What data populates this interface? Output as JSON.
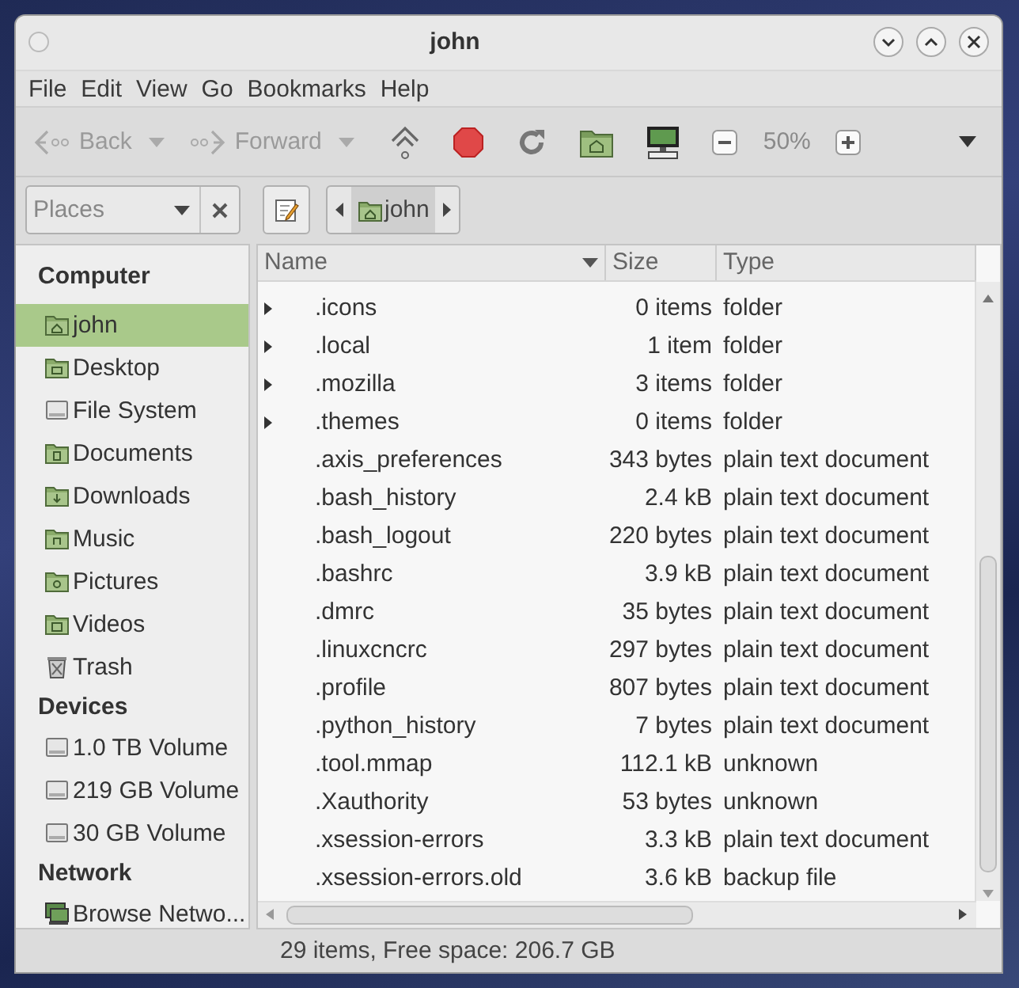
{
  "window": {
    "title": "john"
  },
  "menu": [
    "File",
    "Edit",
    "View",
    "Go",
    "Bookmarks",
    "Help"
  ],
  "toolbar": {
    "back": {
      "label": "Back",
      "disabled": true
    },
    "forward": {
      "label": "Forward",
      "disabled": true
    },
    "zoom": "50%"
  },
  "location": {
    "places": {
      "placeholder": "Places"
    },
    "path": [
      {
        "label": "john",
        "selected": true
      }
    ]
  },
  "sidebar": [
    {
      "title": "Computer",
      "items": [
        {
          "label": "john",
          "kind": "home",
          "selected": true
        },
        {
          "label": "Desktop",
          "kind": "desktop",
          "selected": false
        },
        {
          "label": "File System",
          "kind": "drive",
          "selected": false
        },
        {
          "label": "Documents",
          "kind": "documents",
          "selected": false
        },
        {
          "label": "Downloads",
          "kind": "downloads",
          "selected": false
        },
        {
          "label": "Music",
          "kind": "music",
          "selected": false
        },
        {
          "label": "Pictures",
          "kind": "pictures",
          "selected": false
        },
        {
          "label": "Videos",
          "kind": "videos",
          "selected": false
        },
        {
          "label": "Trash",
          "kind": "trash",
          "selected": false
        }
      ]
    },
    {
      "title": "Devices",
      "items": [
        {
          "label": "1.0 TB Volume",
          "kind": "drive",
          "selected": false
        },
        {
          "label": "219 GB Volume",
          "kind": "drive",
          "selected": false
        },
        {
          "label": "30 GB Volume",
          "kind": "drive",
          "selected": false
        }
      ]
    },
    {
      "title": "Network",
      "items": [
        {
          "label": "Browse Netwo...",
          "kind": "network",
          "selected": false
        }
      ]
    }
  ],
  "table": {
    "columns": [
      {
        "label": "Name",
        "sorted": true
      },
      {
        "label": "Size",
        "sorted": false
      },
      {
        "label": "Type",
        "sorted": false
      }
    ],
    "rows": [
      {
        "name": ".icons",
        "size": "0 items",
        "type": "folder",
        "expandable": true
      },
      {
        "name": ".local",
        "size": "1 item",
        "type": "folder",
        "expandable": true
      },
      {
        "name": ".mozilla",
        "size": "3 items",
        "type": "folder",
        "expandable": true
      },
      {
        "name": ".themes",
        "size": "0 items",
        "type": "folder",
        "expandable": true
      },
      {
        "name": ".axis_preferences",
        "size": "343 bytes",
        "type": "plain text document",
        "expandable": false
      },
      {
        "name": ".bash_history",
        "size": "2.4 kB",
        "type": "plain text document",
        "expandable": false
      },
      {
        "name": ".bash_logout",
        "size": "220 bytes",
        "type": "plain text document",
        "expandable": false
      },
      {
        "name": ".bashrc",
        "size": "3.9 kB",
        "type": "plain text document",
        "expandable": false
      },
      {
        "name": ".dmrc",
        "size": "35 bytes",
        "type": "plain text document",
        "expandable": false
      },
      {
        "name": ".linuxcncrc",
        "size": "297 bytes",
        "type": "plain text document",
        "expandable": false
      },
      {
        "name": ".profile",
        "size": "807 bytes",
        "type": "plain text document",
        "expandable": false
      },
      {
        "name": ".python_history",
        "size": "7 bytes",
        "type": "plain text document",
        "expandable": false
      },
      {
        "name": ".tool.mmap",
        "size": "112.1 kB",
        "type": "unknown",
        "expandable": false
      },
      {
        "name": ".Xauthority",
        "size": "53 bytes",
        "type": "unknown",
        "expandable": false
      },
      {
        "name": ".xsession-errors",
        "size": "3.3 kB",
        "type": "plain text document",
        "expandable": false
      },
      {
        "name": ".xsession-errors.old",
        "size": "3.6 kB",
        "type": "backup file",
        "expandable": false
      }
    ]
  },
  "status_bar": "29 items, Free space: 206.7 GB"
}
